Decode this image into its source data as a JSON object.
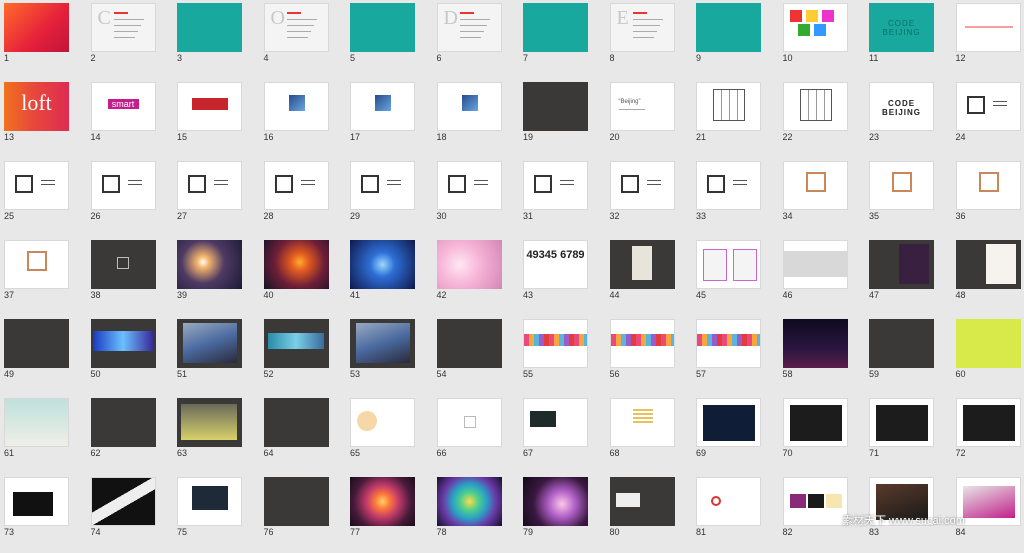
{
  "slides": [
    {
      "n": "1",
      "s": "red"
    },
    {
      "n": "2",
      "s": "light",
      "letter": "C"
    },
    {
      "n": "3",
      "s": "teal"
    },
    {
      "n": "4",
      "s": "light",
      "letter": "O"
    },
    {
      "n": "5",
      "s": "teal"
    },
    {
      "n": "6",
      "s": "light",
      "letter": "D"
    },
    {
      "n": "7",
      "s": "teal"
    },
    {
      "n": "8",
      "s": "light",
      "letter": "E"
    },
    {
      "n": "9",
      "s": "teal"
    },
    {
      "n": "10",
      "s": "white",
      "deco": "blocks"
    },
    {
      "n": "11",
      "s": "teal",
      "text": "CODE BEIJING"
    },
    {
      "n": "12",
      "s": "white",
      "deco": "redline"
    },
    {
      "n": "13",
      "s": "orange",
      "text": "loft"
    },
    {
      "n": "14",
      "s": "white",
      "deco": "smart",
      "text": "smart"
    },
    {
      "n": "15",
      "s": "white",
      "deco": "redbox"
    },
    {
      "n": "16",
      "s": "white",
      "deco": "cube"
    },
    {
      "n": "17",
      "s": "white",
      "deco": "cube"
    },
    {
      "n": "18",
      "s": "white",
      "deco": "cube"
    },
    {
      "n": "19",
      "s": "dark"
    },
    {
      "n": "20",
      "s": "white",
      "deco": "quote",
      "text": "“Beijing”"
    },
    {
      "n": "21",
      "s": "white",
      "deco": "plan"
    },
    {
      "n": "22",
      "s": "white",
      "deco": "plan"
    },
    {
      "n": "23",
      "s": "white",
      "text": "CODE BEIJING"
    },
    {
      "n": "24",
      "s": "white",
      "deco": "box"
    },
    {
      "n": "25",
      "s": "white",
      "deco": "box"
    },
    {
      "n": "26",
      "s": "white",
      "deco": "box"
    },
    {
      "n": "27",
      "s": "white",
      "deco": "box"
    },
    {
      "n": "28",
      "s": "white",
      "deco": "box"
    },
    {
      "n": "29",
      "s": "white",
      "deco": "box"
    },
    {
      "n": "30",
      "s": "white",
      "deco": "box"
    },
    {
      "n": "31",
      "s": "white",
      "deco": "box"
    },
    {
      "n": "32",
      "s": "white",
      "deco": "box"
    },
    {
      "n": "33",
      "s": "white",
      "deco": "box"
    },
    {
      "n": "34",
      "s": "white",
      "deco": "obox"
    },
    {
      "n": "35",
      "s": "white",
      "deco": "obox"
    },
    {
      "n": "36",
      "s": "white",
      "deco": "obox"
    },
    {
      "n": "37",
      "s": "white",
      "deco": "obox"
    },
    {
      "n": "38",
      "s": "dark",
      "deco": "smallbox"
    },
    {
      "n": "39",
      "s": "space"
    },
    {
      "n": "40",
      "s": "circuit"
    },
    {
      "n": "41",
      "s": "blue"
    },
    {
      "n": "42",
      "s": "pink"
    },
    {
      "n": "43",
      "s": "white",
      "text": "49345 6789"
    },
    {
      "n": "44",
      "s": "dark",
      "deco": "bag"
    },
    {
      "n": "45",
      "s": "white",
      "deco": "shirts"
    },
    {
      "n": "46",
      "s": "white",
      "deco": "grayband"
    },
    {
      "n": "47",
      "s": "dark",
      "deco": "poster"
    },
    {
      "n": "48",
      "s": "dark",
      "deco": "poster2"
    },
    {
      "n": "49",
      "s": "dark"
    },
    {
      "n": "50",
      "s": "dark",
      "deco": "banner"
    },
    {
      "n": "51",
      "s": "dark",
      "deco": "billboard"
    },
    {
      "n": "52",
      "s": "dark",
      "deco": "banner2"
    },
    {
      "n": "53",
      "s": "dark",
      "deco": "billboard"
    },
    {
      "n": "54",
      "s": "dark"
    },
    {
      "n": "55",
      "s": "white",
      "deco": "strip"
    },
    {
      "n": "56",
      "s": "white",
      "deco": "strip"
    },
    {
      "n": "57",
      "s": "white",
      "deco": "strip"
    },
    {
      "n": "58",
      "s": "night"
    },
    {
      "n": "59",
      "s": "dark"
    },
    {
      "n": "60",
      "s": "lime"
    },
    {
      "n": "61",
      "s": "white",
      "deco": "street"
    },
    {
      "n": "62",
      "s": "dark"
    },
    {
      "n": "63",
      "s": "dark",
      "deco": "bus"
    },
    {
      "n": "64",
      "s": "dark"
    },
    {
      "n": "65",
      "s": "white",
      "deco": "clock"
    },
    {
      "n": "66",
      "s": "white",
      "deco": "smallbox"
    },
    {
      "n": "67",
      "s": "white",
      "deco": "card"
    },
    {
      "n": "68",
      "s": "white",
      "deco": "logo"
    },
    {
      "n": "69",
      "s": "white",
      "deco": "navy"
    },
    {
      "n": "70",
      "s": "white",
      "deco": "blackinner"
    },
    {
      "n": "71",
      "s": "white",
      "deco": "blackinner"
    },
    {
      "n": "72",
      "s": "white",
      "deco": "blackinner"
    },
    {
      "n": "73",
      "s": "white",
      "deco": "stationery"
    },
    {
      "n": "74",
      "s": "white",
      "deco": "darkdiag"
    },
    {
      "n": "75",
      "s": "white",
      "deco": "monitor"
    },
    {
      "n": "76",
      "s": "dark"
    },
    {
      "n": "77",
      "s": "swirl1"
    },
    {
      "n": "78",
      "s": "swirl2"
    },
    {
      "n": "79",
      "s": "swirl3"
    },
    {
      "n": "80",
      "s": "dark",
      "deco": "darkcard"
    },
    {
      "n": "81",
      "s": "white",
      "deco": "ring"
    },
    {
      "n": "82",
      "s": "white",
      "deco": "swatches"
    },
    {
      "n": "83",
      "s": "white",
      "deco": "cards"
    },
    {
      "n": "84",
      "s": "white",
      "deco": "pink"
    }
  ],
  "watermark": "素材天下 www.sucai.com",
  "colors": {
    "background": "#e8e8e8",
    "accent": "#e33333",
    "teal": "#18a89d",
    "dark": "#3b3938"
  }
}
